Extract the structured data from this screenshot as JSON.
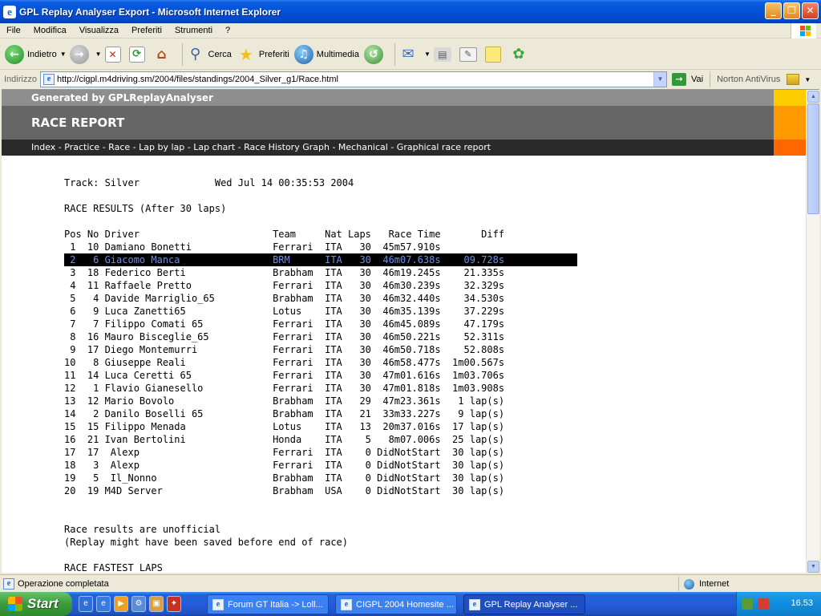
{
  "window": {
    "title": "GPL Replay Analyser Export - Microsoft Internet Explorer",
    "app_icon": "ie-icon"
  },
  "menubar": [
    "File",
    "Modifica",
    "Visualizza",
    "Preferiti",
    "Strumenti",
    "?"
  ],
  "toolbar": {
    "back": "Indietro",
    "search": "Cerca",
    "favorites": "Preferiti",
    "media": "Multimedia"
  },
  "address": {
    "label": "Indirizzo",
    "url": "http://cigpl.m4driving.sm/2004/files/standings/2004_Silver_g1/Race.html",
    "go": "Vai",
    "norton": "Norton AntiVirus"
  },
  "page": {
    "generated_by": "Generated by GPLReplayAnalyser",
    "heading": "RACE REPORT",
    "nav_links": [
      "Index",
      "Practice",
      "Race",
      "Lap by lap",
      "Lap chart",
      "Race History Graph",
      "Mechanical",
      "Graphical race report"
    ],
    "swatch_colors": [
      "#ffcc00",
      "#ff9900",
      "#ff6600"
    ],
    "report": {
      "track_line": "Track: Silver             Wed Jul 14 00:35:53 2004",
      "results_title": "RACE RESULTS (After 30 laps)",
      "header": "Pos No Driver                       Team     Nat Laps   Race Time       Diff",
      "rows": [
        " 1  10 Damiano Bonetti              Ferrari  ITA   30  45m57.910s           ",
        " 2   6 Giacomo Manca                BRM      ITA   30  46m07.638s    09.728s",
        " 3  18 Federico Berti               Brabham  ITA   30  46m19.245s    21.335s",
        " 4  11 Raffaele Pretto              Ferrari  ITA   30  46m30.239s    32.329s",
        " 5   4 Davide Marriglio_65          Brabham  ITA   30  46m32.440s    34.530s",
        " 6   9 Luca Zanetti65               Lotus    ITA   30  46m35.139s    37.229s",
        " 7   7 Filippo Comati 65            Ferrari  ITA   30  46m45.089s    47.179s",
        " 8  16 Mauro Bisceglie_65           Ferrari  ITA   30  46m50.221s    52.311s",
        " 9  17 Diego Montemurri             Ferrari  ITA   30  46m50.718s    52.808s",
        "10   8 Giuseppe Reali               Ferrari  ITA   30  46m58.477s  1m00.567s",
        "11  14 Luca Ceretti 65              Ferrari  ITA   30  47m01.616s  1m03.706s",
        "12   1 Flavio Gianesello            Ferrari  ITA   30  47m01.818s  1m03.908s",
        "13  12 Mario Bovolo                 Brabham  ITA   29  47m23.361s   1 lap(s)",
        "14   2 Danilo Boselli 65            Brabham  ITA   21  33m33.227s   9 lap(s)",
        "15  15 Filippo Menada               Lotus    ITA   13  20m37.016s  17 lap(s)",
        "16  21 Ivan Bertolini               Honda    ITA    5   8m07.006s  25 lap(s)",
        "17  17  Alexp                       Ferrari  ITA    0 DidNotStart  30 lap(s)",
        "18   3  Alexp                       Ferrari  ITA    0 DidNotStart  30 lap(s)",
        "19   5  Il_Nonno                    Brabham  ITA    0 DidNotStart  30 lap(s)",
        "20  19 M4D Server                   Brabham  USA    0 DidNotStart  30 lap(s)"
      ],
      "note1": "Race results are unofficial",
      "note2": "(Replay might have been saved before end of race)",
      "next_section": "RACE FASTEST LAPS"
    }
  },
  "status": {
    "text": "Operazione completata",
    "zone": "Internet"
  },
  "taskbar": {
    "start": "Start",
    "tasks": [
      "Forum GT Italia -> Loll...",
      "CIGPL 2004 Homesite ...",
      "GPL Replay Analyser ..."
    ],
    "clock": "16.53"
  }
}
